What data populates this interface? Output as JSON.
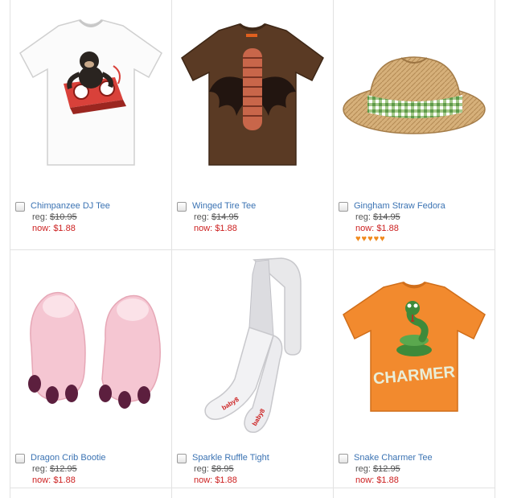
{
  "products": [
    {
      "name": "Chimpanzee DJ Tee",
      "reg_label": "reg:",
      "reg_price": "$10.95",
      "now_label": "now:",
      "now_price": "$1.88",
      "image": "tshirt-white-chimp-dj"
    },
    {
      "name": "Winged Tire Tee",
      "reg_label": "reg:",
      "reg_price": "$14.95",
      "now_label": "now:",
      "now_price": "$1.88",
      "image": "tshirt-brown-winged-tire"
    },
    {
      "name": "Gingham Straw Fedora",
      "reg_label": "reg:",
      "reg_price": "$14.95",
      "now_label": "now:",
      "now_price": "$1.88",
      "rating": "♥♥♥♥♥",
      "image": "straw-fedora-gingham-band"
    },
    {
      "name": "Dragon Crib Bootie",
      "reg_label": "reg:",
      "reg_price": "$12.95",
      "now_label": "now:",
      "now_price": "$1.88",
      "image": "pink-dragon-booties"
    },
    {
      "name": "Sparkle Ruffle Tight",
      "reg_label": "reg:",
      "reg_price": "$8.95",
      "now_label": "now:",
      "now_price": "$1.88",
      "image": "white-tights"
    },
    {
      "name": "Snake Charmer Tee",
      "reg_label": "reg:",
      "reg_price": "$12.95",
      "now_label": "now:",
      "now_price": "$1.88",
      "image": "tshirt-orange-snake-charmer"
    }
  ],
  "tights_text": "baby8",
  "shirt_text": "CHARMER",
  "colors": {
    "link": "#3b73b3",
    "sale": "#cc1f1f",
    "rating": "#f08a1e",
    "grid": "#e2e2e2"
  }
}
